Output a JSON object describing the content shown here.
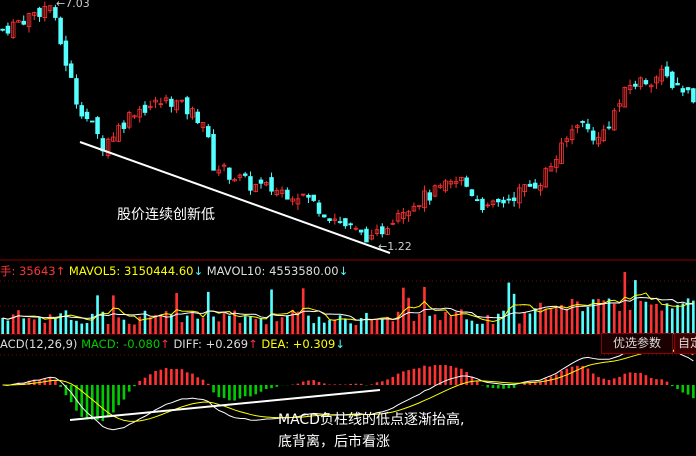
{
  "colors": {
    "up": "#ff3333",
    "down": "#54ffff",
    "ma5": "#ffff00",
    "ma10": "#ffffff",
    "grid": "#8b0000",
    "macd_neg": "#00cc00"
  },
  "volume_legend": {
    "prefix": "手: ",
    "vol": "35643",
    "vol_arrow": "↑",
    "mavol5": "MAVOL5: 3150444.60",
    "mavol5_arrow": "↓",
    "mavol10": "MAVOL10: 4553580.00",
    "mavol10_arrow": "↓"
  },
  "macd_legend": {
    "name": "ACD(12,26,9)",
    "macd": "MACD: -0.080",
    "macd_arrow": "↑",
    "diff": "DIFF: +0.269",
    "diff_arrow": "↑",
    "dea": "DEA: +0.309",
    "dea_arrow": "↓"
  },
  "buttons": {
    "preferred": "优选参数",
    "custom": "自定"
  },
  "annotations": {
    "price": "股价连续创新低",
    "macd_line1": "MACD负柱线的低点逐渐抬高,",
    "macd_line2": "底背离，后市看涨"
  },
  "chart_data": {
    "type": "candlestick",
    "price_high_label": "7.03",
    "price_low_label": "1.22",
    "price_range": [
      1.22,
      7.03
    ],
    "keypoints": [
      [
        0,
        6.42
      ],
      [
        9,
        7.03
      ],
      [
        14,
        4.7
      ],
      [
        19,
        3.6
      ],
      [
        25,
        4.46
      ],
      [
        32,
        4.7
      ],
      [
        38,
        4.21
      ],
      [
        40,
        3.11
      ],
      [
        47,
        2.62
      ],
      [
        57,
        2.37
      ],
      [
        62,
        1.88
      ],
      [
        70,
        1.22
      ],
      [
        75,
        2.01
      ],
      [
        87,
        2.74
      ],
      [
        92,
        2.01
      ],
      [
        102,
        2.74
      ],
      [
        106,
        3.48
      ],
      [
        109,
        4.21
      ],
      [
        113,
        3.72
      ],
      [
        119,
        5.07
      ],
      [
        125,
        5.31
      ],
      [
        131,
        4.82
      ]
    ],
    "candle_count": 132,
    "macd_params": [
      12,
      26,
      9
    ]
  }
}
